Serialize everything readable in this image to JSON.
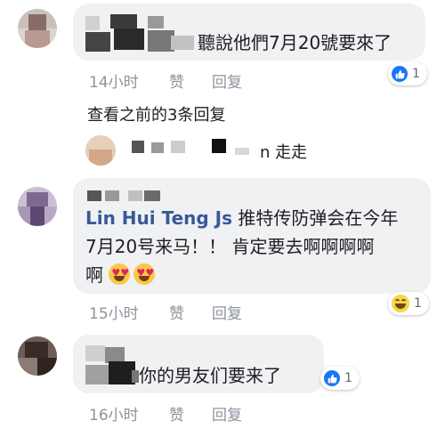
{
  "comments": [
    {
      "text": "聽說他們7月20號要來了",
      "time": "14小时",
      "like_label": "赞",
      "reply_label": "回复",
      "reaction_count": "1",
      "reaction_icon": "like-icon"
    },
    {
      "author": "Lin Hui Teng Js",
      "text_line1": " 推特传防弹会在今年",
      "text_line2": "7月20号来马！！ 肯定要去啊啊啊啊",
      "text_line3": "啊",
      "time": "15小时",
      "like_label": "赞",
      "reply_label": "回复",
      "reaction_count": "1",
      "reaction_icon": "haha-icon"
    },
    {
      "text": "你的男友们要来了",
      "time": "16小时",
      "like_label": "赞",
      "reply_label": "回复",
      "reaction_count": "1",
      "reaction_icon": "like-icon"
    }
  ],
  "view_previous": "查看之前的3条回复",
  "reply_preview": "n 走走",
  "colors": {
    "bubble": "#eff1f3",
    "author": "#385898",
    "meta": "#8d949e",
    "like_blue": "#1877f2"
  }
}
